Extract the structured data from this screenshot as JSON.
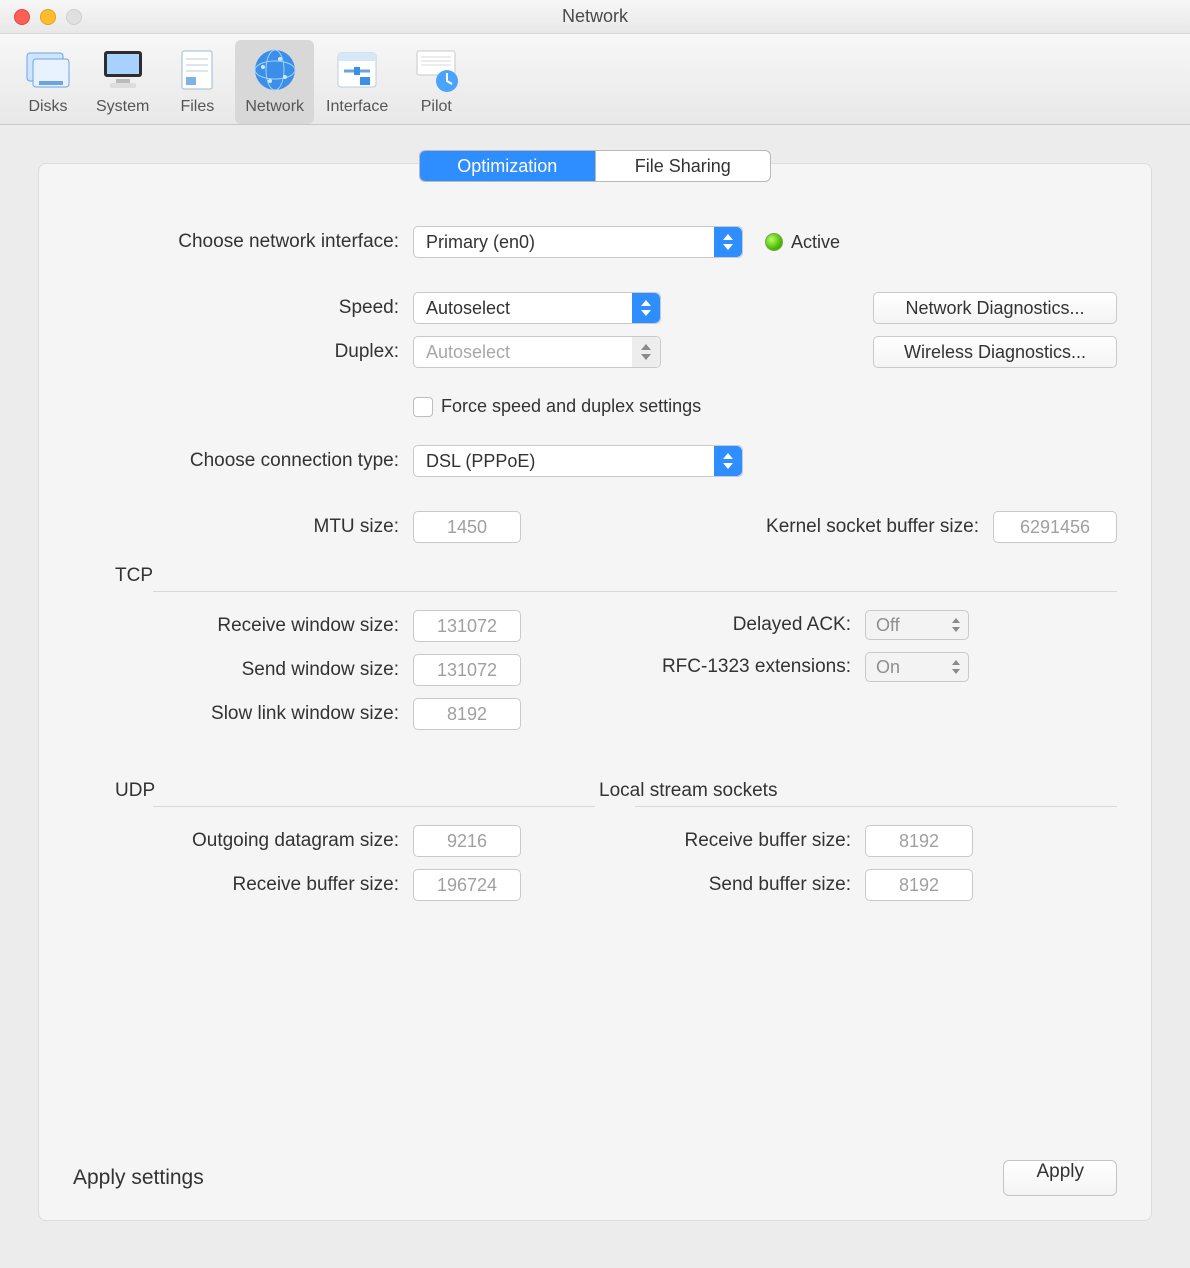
{
  "window": {
    "title": "Network"
  },
  "toolbar": {
    "items": [
      {
        "label": "Disks"
      },
      {
        "label": "System"
      },
      {
        "label": "Files"
      },
      {
        "label": "Network"
      },
      {
        "label": "Interface"
      },
      {
        "label": "Pilot"
      }
    ]
  },
  "tabs": {
    "optimization": "Optimization",
    "filesharing": "File Sharing"
  },
  "labels": {
    "chooseInterface": "Choose network interface:",
    "speed": "Speed:",
    "duplex": "Duplex:",
    "force": "Force speed and duplex settings",
    "chooseConnType": "Choose connection type:",
    "mtu": "MTU size:",
    "kernelBuf": "Kernel socket buffer size:",
    "tcp": "TCP",
    "recvWin": "Receive window size:",
    "sendWin": "Send window size:",
    "slowLink": "Slow link window size:",
    "delayedAck": "Delayed ACK:",
    "rfc1323": "RFC-1323 extensions:",
    "udp": "UDP",
    "outDgram": "Outgoing datagram size:",
    "recvBuf": "Receive buffer size:",
    "localStream": "Local stream sockets",
    "lsRecv": "Receive buffer size:",
    "lsSend": "Send buffer size:",
    "applySettings": "Apply settings",
    "status": "Active"
  },
  "values": {
    "interface": "Primary (en0)",
    "speed": "Autoselect",
    "duplex": "Autoselect",
    "connType": "DSL (PPPoE)",
    "mtu": "1450",
    "kernelBuf": "6291456",
    "recvWin": "131072",
    "sendWin": "131072",
    "slowLink": "8192",
    "delayedAck": "Off",
    "rfc1323": "On",
    "outDgram": "9216",
    "udpRecvBuf": "196724",
    "lsRecv": "8192",
    "lsSend": "8192"
  },
  "buttons": {
    "netDiag": "Network Diagnostics...",
    "wirelessDiag": "Wireless Diagnostics...",
    "apply": "Apply"
  }
}
